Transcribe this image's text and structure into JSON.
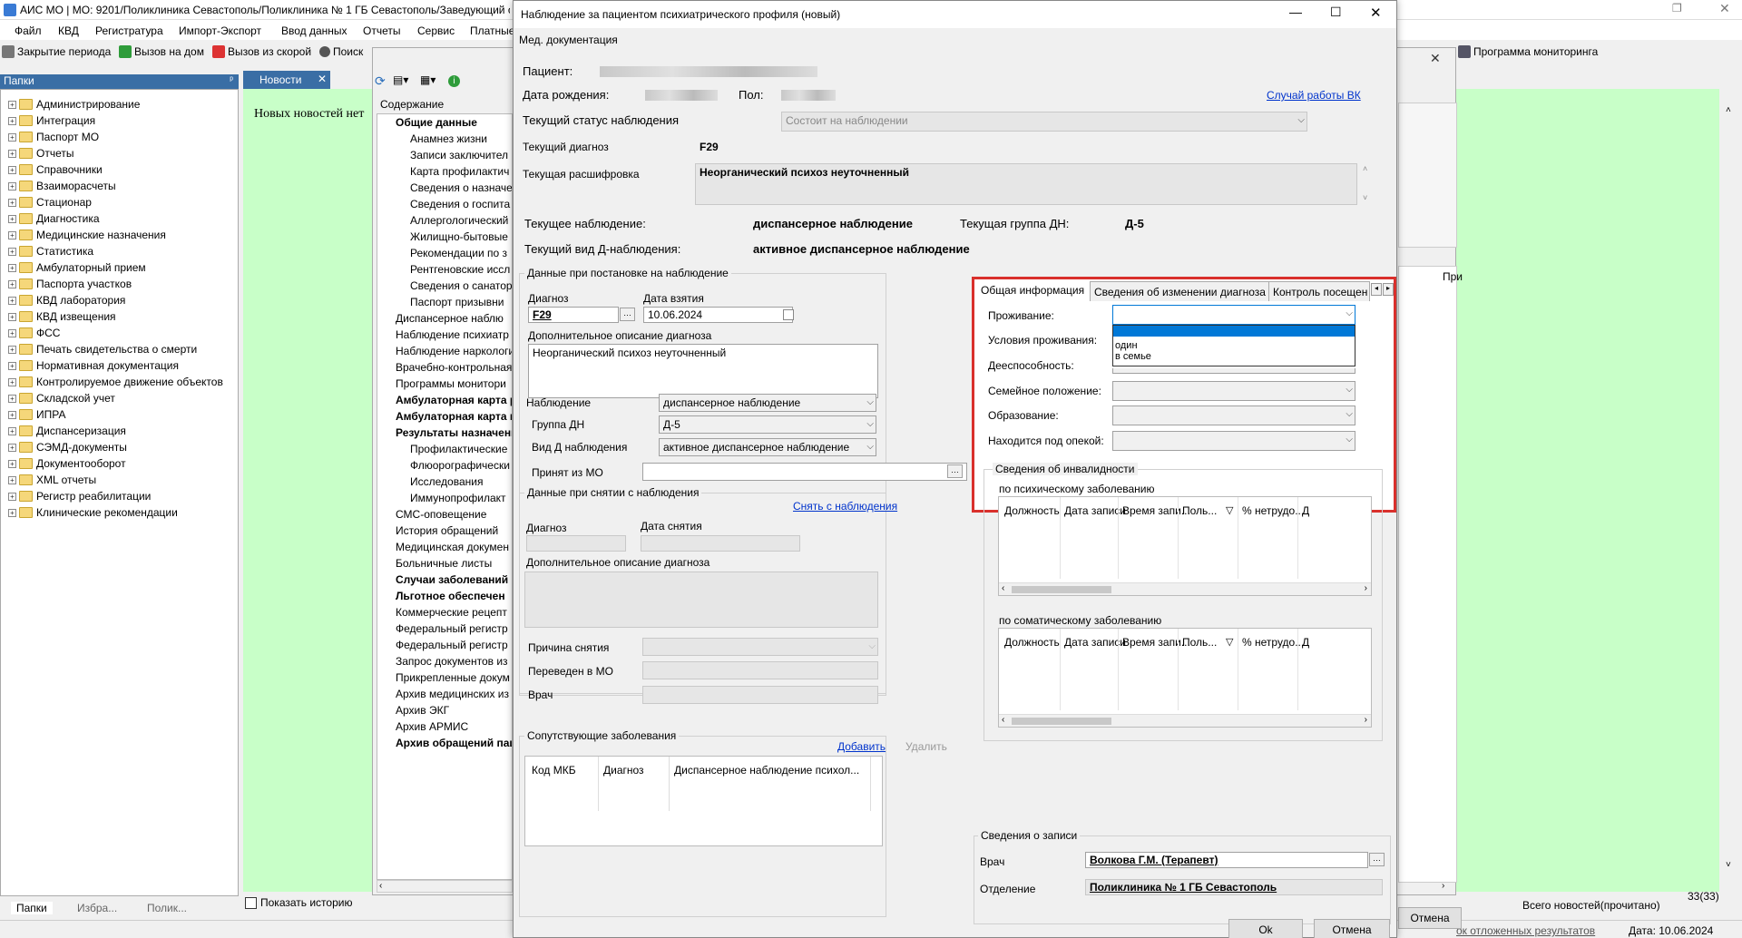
{
  "app": {
    "title": "АИС МО | МО: 9201/Поликлиника Севастополь/Поликлиника № 1 ГБ Севастополь/Заведующий о",
    "menu": [
      "Файл",
      "КВД",
      "Регистратура",
      "Импорт-Экспорт",
      "Ввод данных",
      "Отчеты",
      "Сервис",
      "Платные"
    ],
    "toolbar": {
      "close_period": "Закрытие периода",
      "home_call": "Вызов на дом",
      "ambulance_call": "Вызов из скорой",
      "search": "Поиск",
      "monitoring": "Программа мониторинга"
    },
    "folders_header": "Папки",
    "news_tab": "Новости",
    "news_empty": "Новых новостей нет",
    "folders": [
      "Администрирование",
      "Интеграция",
      "Паспорт МО",
      "Отчеты",
      "Справочники",
      "Взаиморасчеты",
      "Стационар",
      "Диагностика",
      "Медицинские назначения",
      "Статистика",
      "Амбулаторный прием",
      "Паспорта участков",
      "КВД лаборатория",
      "КВД извещения",
      "ФСС",
      "Печать свидетельства о смерти",
      "Нормативная документация",
      "Контролируемое движение объектов",
      "Складской учет",
      "ИПРА",
      "Диспансеризация",
      "СЭМД-документы",
      "Документооборот",
      "XML отчеты",
      "Регистр реабилитации",
      "Клинические рекомендации"
    ],
    "bottom_tabs": [
      "Папки",
      "Избра...",
      "Полик..."
    ],
    "show_history": "Показать историю",
    "news_total": "Всего новостей(прочитано)",
    "news_count": "33(33)",
    "status_deferred": "ок отложенных результатов",
    "status_date": "Дата: 10.06.2024",
    "cancel_behind": "Отмена",
    "col_behind": "При"
  },
  "contents": {
    "header": "Содержание",
    "items": [
      {
        "text": "Общие данные",
        "bold": true,
        "level": 0
      },
      {
        "text": "Анамнез жизни",
        "level": 1
      },
      {
        "text": "Записи заключител",
        "level": 1
      },
      {
        "text": "Карта профилактич",
        "level": 1
      },
      {
        "text": "Сведения о назначе",
        "level": 1
      },
      {
        "text": "Сведения о госпита",
        "level": 1
      },
      {
        "text": "Аллергологический",
        "level": 1
      },
      {
        "text": "Жилищно-бытовые",
        "level": 1
      },
      {
        "text": "Рекомендации по з",
        "level": 1
      },
      {
        "text": "Рентгеновские иссл",
        "level": 1
      },
      {
        "text": "Сведения о санатор",
        "level": 1
      },
      {
        "text": "Паспорт призывни",
        "level": 1
      },
      {
        "text": "Диспансерное наблю",
        "level": 0
      },
      {
        "text": "Наблюдение психиатр",
        "level": 0
      },
      {
        "text": "Наблюдение наркологи",
        "level": 0
      },
      {
        "text": "Врачебно-контрольная",
        "level": 0
      },
      {
        "text": "Программы монитори",
        "level": 0
      },
      {
        "text": "Амбулаторная карта р",
        "bold": true,
        "level": 0
      },
      {
        "text": "Амбулаторная карта в",
        "bold": true,
        "level": 0
      },
      {
        "text": "Результаты назначени",
        "bold": true,
        "level": 0
      },
      {
        "text": "Профилактические",
        "level": 1
      },
      {
        "text": "Флюорографически",
        "level": 1
      },
      {
        "text": "Исследования",
        "level": 1
      },
      {
        "text": "Иммунопрофилакт",
        "level": 1
      },
      {
        "text": "СМС-оповещение",
        "level": 0
      },
      {
        "text": "История обращений",
        "level": 0
      },
      {
        "text": "Медицинская докумен",
        "level": 0
      },
      {
        "text": "Больничные листы",
        "level": 0
      },
      {
        "text": "Случаи заболеваний",
        "bold": true,
        "level": 0
      },
      {
        "text": "Льготное обеспечен",
        "bold": true,
        "level": 0
      },
      {
        "text": "Коммерческие рецепт",
        "level": 0
      },
      {
        "text": "Федеральный регистр",
        "level": 0
      },
      {
        "text": "Федеральный регистр",
        "level": 0
      },
      {
        "text": "Запрос документов из",
        "level": 0
      },
      {
        "text": "Прикрепленные докум",
        "level": 0
      },
      {
        "text": "Архив медицинских из",
        "level": 0
      },
      {
        "text": "Архив ЭКГ",
        "level": 0
      },
      {
        "text": "Архив АРМИС",
        "level": 0
      },
      {
        "text": "Архив обращений паци",
        "bold": true,
        "level": 0
      }
    ]
  },
  "dialog": {
    "title": "Наблюдение за пациентом психиатрического профиля (новый)",
    "menu": "Мед. документация",
    "patient_label": "Пациент:",
    "birth_label": "Дата рождения:",
    "sex_label": "Пол:",
    "vk_link": "Случай работы ВК",
    "status_label": "Текущий статус наблюдения",
    "status_value": "Состоит на наблюдении",
    "diag_label": "Текущий диагноз",
    "diag_value": "F29",
    "decode_label": "Текущая расшифровка",
    "decode_value": "Неорганический психоз неуточненный",
    "obs_label": "Текущее наблюдение:",
    "obs_value": "диспансерное наблюдение",
    "group_label": "Текущая группа ДН:",
    "group_value": "Д-5",
    "dtype_label": "Текущий вид Д-наблюдения:",
    "dtype_value": "активное диспансерное наблюдение",
    "reg": {
      "title": "Данные при постановке на наблюдение",
      "diag_label": "Диагноз",
      "diag_value": "F29",
      "date_label": "Дата взятия",
      "date_value": "10.06.2024",
      "desc_label": "Дополнительное описание диагноза",
      "desc_value": "Неорганический психоз неуточненный",
      "obs_label": "Наблюдение",
      "obs_value": "диспансерное наблюдение",
      "group_label": "Группа ДН",
      "group_value": "Д-5",
      "type_label": "Вид Д наблюдения",
      "type_value": "активное диспансерное наблюдение",
      "from_label": "Принят из МО"
    },
    "dereg": {
      "title": "Данные при снятии с наблюдения",
      "remove_link": "Снять с наблюдения",
      "diag_label": "Диагноз",
      "date_label": "Дата снятия",
      "desc_label": "Дополнительное описание диагноза",
      "reason_label": "Причина снятия",
      "transfer_label": "Переведен в МО",
      "doctor_label": "Врач"
    },
    "comorbid": {
      "title": "Сопутствующие заболевания",
      "add": "Добавить",
      "delete": "Удалить",
      "cols": [
        "Код МКБ",
        "Диагноз",
        "Диспансерное наблюдение психол..."
      ]
    },
    "tabs": [
      "Общая информация",
      "Сведения об изменении диагноза",
      "Контроль посещен"
    ],
    "general": {
      "living_label": "Проживание:",
      "conditions_label": "Условия проживания:",
      "capacity_label": "Дееспособность:",
      "marital_label": "Семейное положение:",
      "education_label": "Образование:",
      "custody_label": "Находится под опекой:",
      "living_options": [
        "один",
        "в семье"
      ]
    },
    "disability": {
      "title": "Сведения об инвалидности",
      "psych_label": "по психическому заболеванию",
      "somatic_label": "по соматическому заболеванию",
      "cols": [
        "Должность",
        "Дата записи",
        "Время запи...",
        "Поль...",
        "% нетрудо...",
        "Д"
      ]
    },
    "record": {
      "title": "Сведения о записи",
      "doctor_label": "Врач",
      "doctor_value": "Волкова Г.М. (Терапевт)",
      "dept_label": "Отделение",
      "dept_value": "Поликлиника № 1 ГБ Севастополь"
    },
    "ok": "Ok",
    "cancel": "Отмена"
  },
  "colors": {
    "highlight": "#d9302c",
    "selection": "#0078d7",
    "link": "#0033cc",
    "news_bg": "#c8ffc8",
    "tab_active": "#3a6ea5"
  }
}
